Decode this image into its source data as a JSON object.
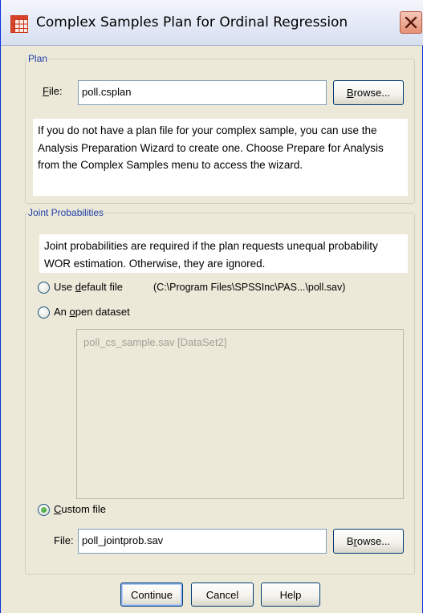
{
  "window": {
    "title": "Complex Samples Plan for Ordinal Regression",
    "icon": "table-grid-icon",
    "close_icon": "close-x-icon"
  },
  "plan": {
    "legend": "Plan",
    "file_label_accel": "F",
    "file_label_rest": "ile:",
    "file_value": "poll.csplan",
    "browse_accel": "B",
    "browse_rest": "rowse...",
    "info_text": "If you do not have a plan file for your complex sample, you can use the Analysis Preparation Wizard to create one. Choose Prepare for Analysis from the Complex Samples menu to access the wizard."
  },
  "joint": {
    "legend": "Joint Probabilities",
    "info_text": "Joint probabilities are required if the plan requests unequal probability WOR estimation. Otherwise, they are ignored.",
    "default_file": {
      "label_pre": "Use ",
      "label_accel": "d",
      "label_post": "efault file",
      "path": "(C:\\Program Files\\SPSSInc\\PAS...\\poll.sav)",
      "selected": false
    },
    "open_dataset": {
      "label_pre": "An ",
      "label_accel": "o",
      "label_post": "pen dataset",
      "selected": false,
      "items": [
        "poll_cs_sample.sav [DataSet2]"
      ]
    },
    "custom_file": {
      "label_accel": "C",
      "label_post": "ustom file",
      "selected": true,
      "file_label": "File:",
      "file_value": "poll_jointprob.sav",
      "browse_pre": "B",
      "browse_accel": "r",
      "browse_post": "owse..."
    }
  },
  "buttons": {
    "continue": "Continue",
    "cancel": "Cancel",
    "help": "Help"
  },
  "colors": {
    "legend_text": "#1f3ea7",
    "window_bg": "#ece9d8",
    "radio_selected": "#21a121"
  }
}
